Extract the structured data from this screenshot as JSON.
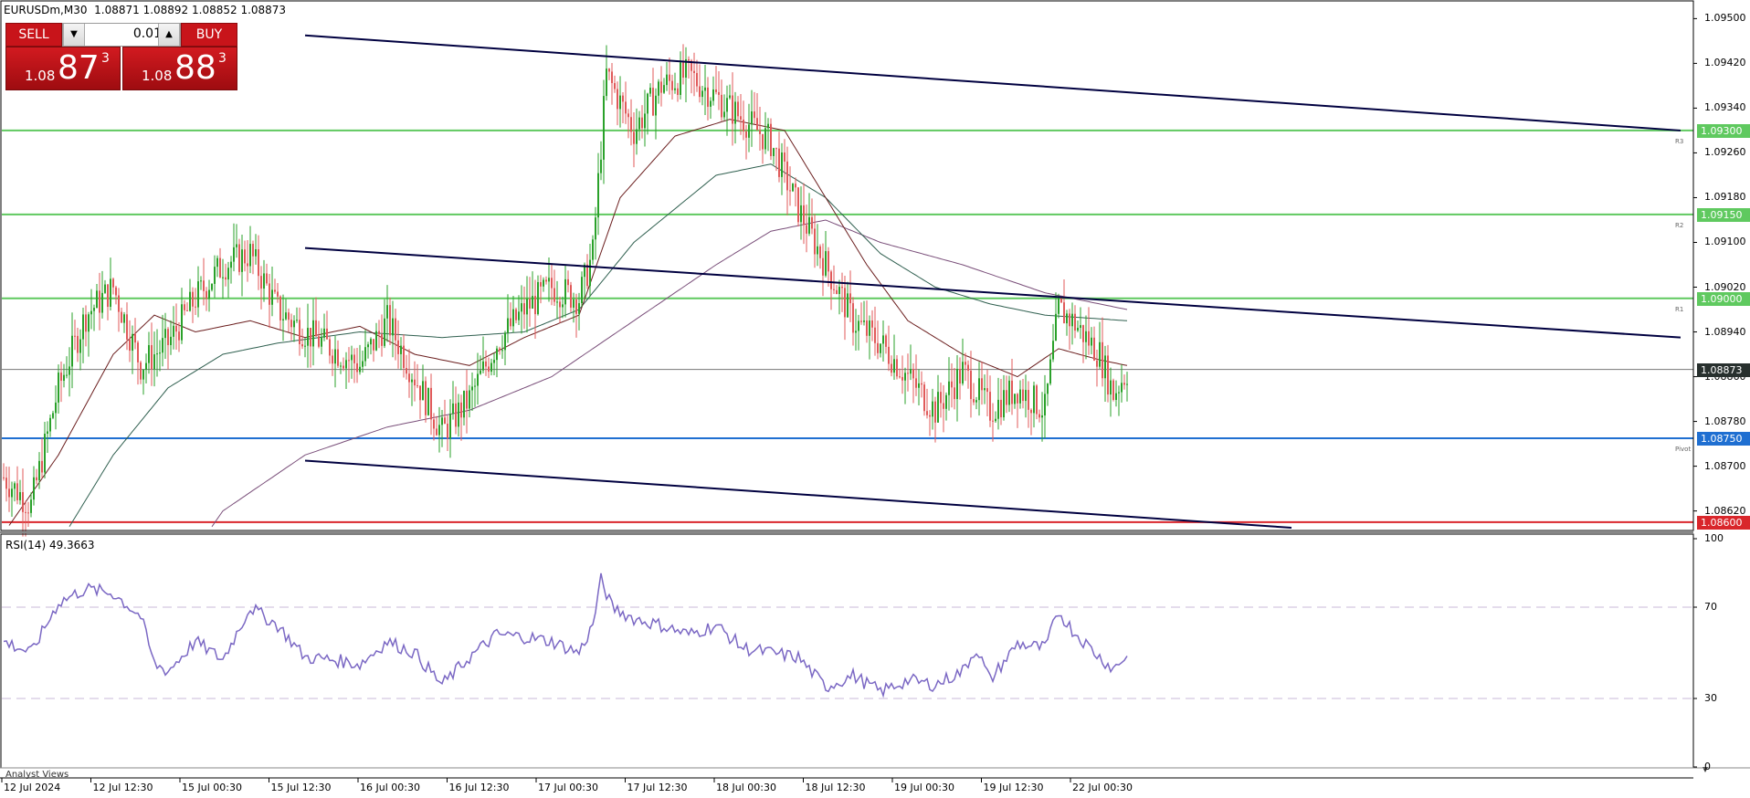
{
  "header": {
    "symbol_timeframe": "EURUSDm,M30",
    "ohlc": "1.08871 1.08892 1.08852 1.08873"
  },
  "trade_panel": {
    "sell_label": "SELL",
    "buy_label": "BUY",
    "lot_value": "0.01",
    "sell_price": {
      "prefix": "1.08",
      "big": "87",
      "sup": "3"
    },
    "buy_price": {
      "prefix": "1.08",
      "big": "88",
      "sup": "3"
    }
  },
  "price_axis": {
    "ticks": [
      "1.09500",
      "1.09420",
      "1.09340",
      "1.09260",
      "1.09180",
      "1.09100",
      "1.09020",
      "1.08940",
      "1.08860",
      "1.08780",
      "1.08700",
      "1.08620"
    ],
    "tick_values": [
      1.095,
      1.0942,
      1.0934,
      1.0926,
      1.0918,
      1.091,
      1.0902,
      1.0894,
      1.0886,
      1.0878,
      1.087,
      1.0862
    ]
  },
  "levels": [
    {
      "label": "1.09300",
      "value": 1.093,
      "color": "#5fc95f",
      "tag": "R3"
    },
    {
      "label": "1.09150",
      "value": 1.0915,
      "color": "#5fc95f",
      "tag": "R2"
    },
    {
      "label": "1.09000",
      "value": 1.09,
      "color": "#5fc95f",
      "tag": "R1"
    },
    {
      "label": "1.08750",
      "value": 1.0875,
      "color": "#1f6fd1",
      "tag": "Pivot"
    },
    {
      "label": "1.08600",
      "value": 1.086,
      "color": "#d9262b",
      "tag": ""
    }
  ],
  "current_price": {
    "label": "1.08873",
    "value": 1.08873,
    "color": "#28302e"
  },
  "rsi": {
    "title": "RSI(14) 49.3663",
    "ticks": [
      "100",
      "70",
      "30",
      "0"
    ],
    "tick_values": [
      100,
      70,
      30,
      0
    ],
    "color": "#7b68c4"
  },
  "time_axis": [
    "12 Jul 2024",
    "12 Jul 12:30",
    "15 Jul 00:30",
    "15 Jul 12:30",
    "16 Jul 00:30",
    "16 Jul 12:30",
    "17 Jul 00:30",
    "17 Jul 12:30",
    "18 Jul 00:30",
    "18 Jul 12:30",
    "19 Jul 00:30",
    "19 Jul 12:30",
    "22 Jul 00:30"
  ],
  "bottom_tab": "Analyst Views",
  "colors": {
    "bull": "#2aa12a",
    "bear": "#e05a5a",
    "trend": "#000040",
    "ma_fast": "#6b1e1e",
    "ma_mid": "#2f5f4f",
    "ma_slow": "#7a4f7a"
  },
  "chart_data": {
    "type": "candlestick",
    "symbol": "EURUSDm",
    "timeframe": "M30",
    "ylim": [
      1.0859,
      1.0953
    ],
    "anchors": [
      [
        0,
        1.0868
      ],
      [
        10,
        1.0863
      ],
      [
        20,
        1.0884
      ],
      [
        30,
        1.0897
      ],
      [
        40,
        1.0902
      ],
      [
        50,
        1.0888
      ],
      [
        60,
        1.0892
      ],
      [
        70,
        1.09
      ],
      [
        80,
        1.0906
      ],
      [
        90,
        1.0908
      ],
      [
        100,
        1.0898
      ],
      [
        110,
        1.0894
      ],
      [
        120,
        1.0891
      ],
      [
        130,
        1.0888
      ],
      [
        140,
        1.0896
      ],
      [
        150,
        1.0886
      ],
      [
        160,
        1.0876
      ],
      [
        170,
        1.0882
      ],
      [
        180,
        1.0892
      ],
      [
        190,
        1.0898
      ],
      [
        200,
        1.0902
      ],
      [
        210,
        1.09
      ],
      [
        215,
        1.0908
      ],
      [
        220,
        1.094
      ],
      [
        230,
        1.093
      ],
      [
        240,
        1.0938
      ],
      [
        250,
        1.094
      ],
      [
        260,
        1.0936
      ],
      [
        270,
        1.0932
      ],
      [
        280,
        1.0928
      ],
      [
        290,
        1.0916
      ],
      [
        300,
        1.0906
      ],
      [
        310,
        1.0896
      ],
      [
        320,
        1.0892
      ],
      [
        330,
        1.0886
      ],
      [
        340,
        1.088
      ],
      [
        350,
        1.0887
      ],
      [
        360,
        1.088
      ],
      [
        370,
        1.0884
      ],
      [
        380,
        1.088
      ],
      [
        385,
        1.0898
      ],
      [
        390,
        1.0896
      ],
      [
        400,
        1.089
      ],
      [
        405,
        1.0883
      ],
      [
        410,
        1.0887
      ]
    ],
    "ma_fast_anchors": [
      [
        0,
        1.0858
      ],
      [
        20,
        1.0872
      ],
      [
        40,
        1.089
      ],
      [
        55,
        1.0897
      ],
      [
        70,
        1.0894
      ],
      [
        90,
        1.0896
      ],
      [
        110,
        1.0893
      ],
      [
        130,
        1.0895
      ],
      [
        150,
        1.089
      ],
      [
        170,
        1.0888
      ],
      [
        190,
        1.0893
      ],
      [
        210,
        1.0897
      ],
      [
        225,
        1.0918
      ],
      [
        245,
        1.0929
      ],
      [
        265,
        1.0932
      ],
      [
        285,
        1.093
      ],
      [
        300,
        1.0918
      ],
      [
        315,
        1.0906
      ],
      [
        330,
        1.0896
      ],
      [
        350,
        1.089
      ],
      [
        370,
        1.0886
      ],
      [
        385,
        1.0891
      ],
      [
        400,
        1.0889
      ],
      [
        410,
        1.0888
      ]
    ],
    "ma_mid_anchors": [
      [
        20,
        1.0856
      ],
      [
        40,
        1.0872
      ],
      [
        60,
        1.0884
      ],
      [
        80,
        1.089
      ],
      [
        100,
        1.0892
      ],
      [
        130,
        1.0894
      ],
      [
        160,
        1.0893
      ],
      [
        190,
        1.0894
      ],
      [
        210,
        1.0898
      ],
      [
        230,
        1.091
      ],
      [
        260,
        1.0922
      ],
      [
        280,
        1.0924
      ],
      [
        300,
        1.0918
      ],
      [
        320,
        1.0908
      ],
      [
        340,
        1.0902
      ],
      [
        360,
        1.0899
      ],
      [
        380,
        1.0897
      ],
      [
        410,
        1.0896
      ]
    ],
    "ma_slow_anchors": [
      [
        60,
        1.0848
      ],
      [
        80,
        1.0862
      ],
      [
        110,
        1.0872
      ],
      [
        140,
        1.0877
      ],
      [
        170,
        1.088
      ],
      [
        200,
        1.0886
      ],
      [
        230,
        1.0896
      ],
      [
        260,
        1.0906
      ],
      [
        280,
        1.0912
      ],
      [
        300,
        1.0914
      ],
      [
        320,
        1.091
      ],
      [
        350,
        1.0906
      ],
      [
        380,
        1.0901
      ],
      [
        410,
        1.0898
      ]
    ],
    "trend_lines": [
      {
        "x1": 110,
        "y1": 1.0947,
        "x2": 612,
        "y2": 1.093
      },
      {
        "x1": 110,
        "y1": 1.0909,
        "x2": 612,
        "y2": 1.0893
      },
      {
        "x1": 110,
        "y1": 1.0871,
        "x2": 470,
        "y2": 1.0859
      }
    ],
    "rsi_anchors": [
      [
        0,
        55
      ],
      [
        10,
        50
      ],
      [
        20,
        72
      ],
      [
        30,
        78
      ],
      [
        40,
        76
      ],
      [
        50,
        66
      ],
      [
        55,
        45
      ],
      [
        60,
        42
      ],
      [
        70,
        55
      ],
      [
        80,
        47
      ],
      [
        90,
        70
      ],
      [
        100,
        62
      ],
      [
        110,
        48
      ],
      [
        120,
        47
      ],
      [
        130,
        45
      ],
      [
        140,
        55
      ],
      [
        150,
        50
      ],
      [
        160,
        36
      ],
      [
        170,
        48
      ],
      [
        180,
        58
      ],
      [
        190,
        57
      ],
      [
        200,
        55
      ],
      [
        210,
        50
      ],
      [
        215,
        62
      ],
      [
        218,
        82
      ],
      [
        222,
        70
      ],
      [
        230,
        65
      ],
      [
        240,
        62
      ],
      [
        250,
        58
      ],
      [
        260,
        62
      ],
      [
        270,
        52
      ],
      [
        280,
        50
      ],
      [
        290,
        48
      ],
      [
        300,
        35
      ],
      [
        310,
        40
      ],
      [
        320,
        33
      ],
      [
        330,
        38
      ],
      [
        340,
        36
      ],
      [
        350,
        42
      ],
      [
        355,
        52
      ],
      [
        360,
        38
      ],
      [
        370,
        54
      ],
      [
        380,
        52
      ],
      [
        385,
        68
      ],
      [
        390,
        60
      ],
      [
        400,
        48
      ],
      [
        405,
        43
      ],
      [
        410,
        49
      ]
    ]
  }
}
